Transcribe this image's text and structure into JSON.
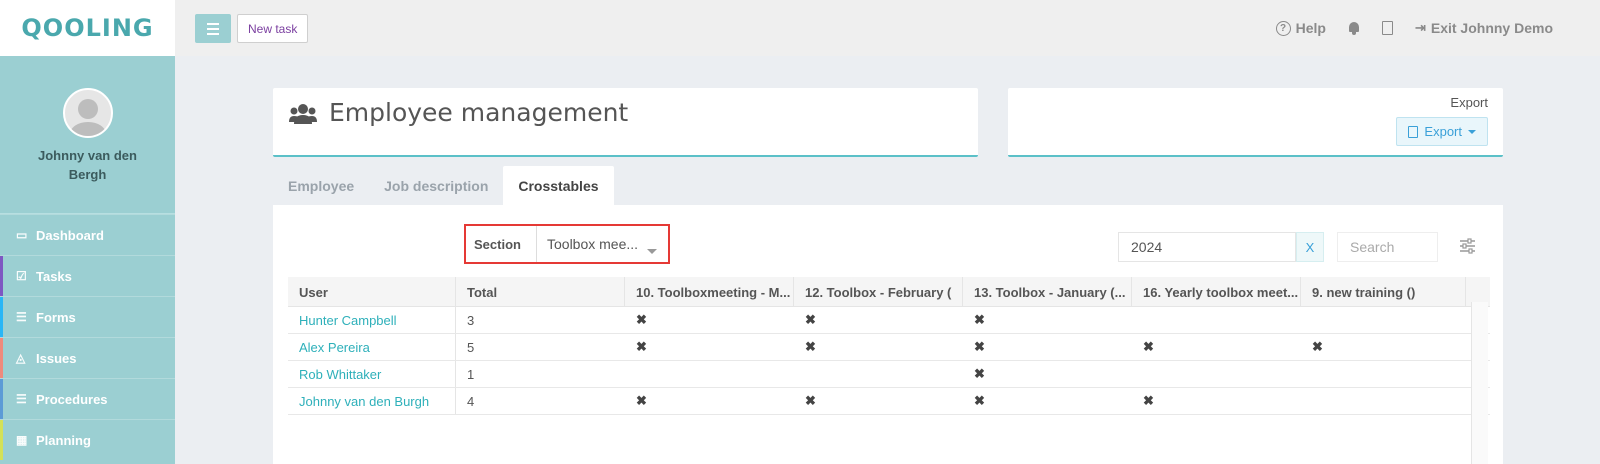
{
  "sidebar": {
    "logo": "QOOLING",
    "profile_name": "Johnny van den Bergh",
    "items": [
      {
        "label": "Dashboard",
        "color": "#9bcfd2"
      },
      {
        "label": "Tasks",
        "color": "#7e57c2"
      },
      {
        "label": "Forms",
        "color": "#29b6f6"
      },
      {
        "label": "Issues",
        "color": "#ef8a7d"
      },
      {
        "label": "Procedures",
        "color": "#5c9bd6"
      },
      {
        "label": "Planning",
        "color": "#d4e157"
      }
    ]
  },
  "topbar": {
    "new_task": "New task",
    "help": "Help",
    "exit": "Exit Johnny Demo"
  },
  "header": {
    "title": "Employee management",
    "export_label": "Export",
    "export_button": "Export"
  },
  "tabs": [
    "Employee",
    "Job description",
    "Crosstables"
  ],
  "active_tab": "Crosstables",
  "filters": {
    "section_label": "Section",
    "section_value": "Toolbox mee...",
    "year": "2024",
    "clear": "X",
    "search_placeholder": "Search"
  },
  "table": {
    "columns": [
      "User",
      "Total",
      "10. Toolboxmeeting - M...",
      "12. Toolbox - February (",
      "13. Toolbox - January (...",
      "16. Yearly toolbox meet...",
      "9. new training ()"
    ],
    "rows": [
      {
        "user": "Hunter Campbell",
        "total": "3",
        "marks": [
          true,
          true,
          true,
          false,
          false
        ]
      },
      {
        "user": "Alex Pereira",
        "total": "5",
        "marks": [
          true,
          true,
          true,
          true,
          true
        ]
      },
      {
        "user": "Rob Whittaker",
        "total": "1",
        "marks": [
          false,
          false,
          true,
          false,
          false
        ]
      },
      {
        "user": "Johnny van den Burgh",
        "total": "4",
        "marks": [
          true,
          true,
          true,
          true,
          false
        ]
      }
    ]
  }
}
